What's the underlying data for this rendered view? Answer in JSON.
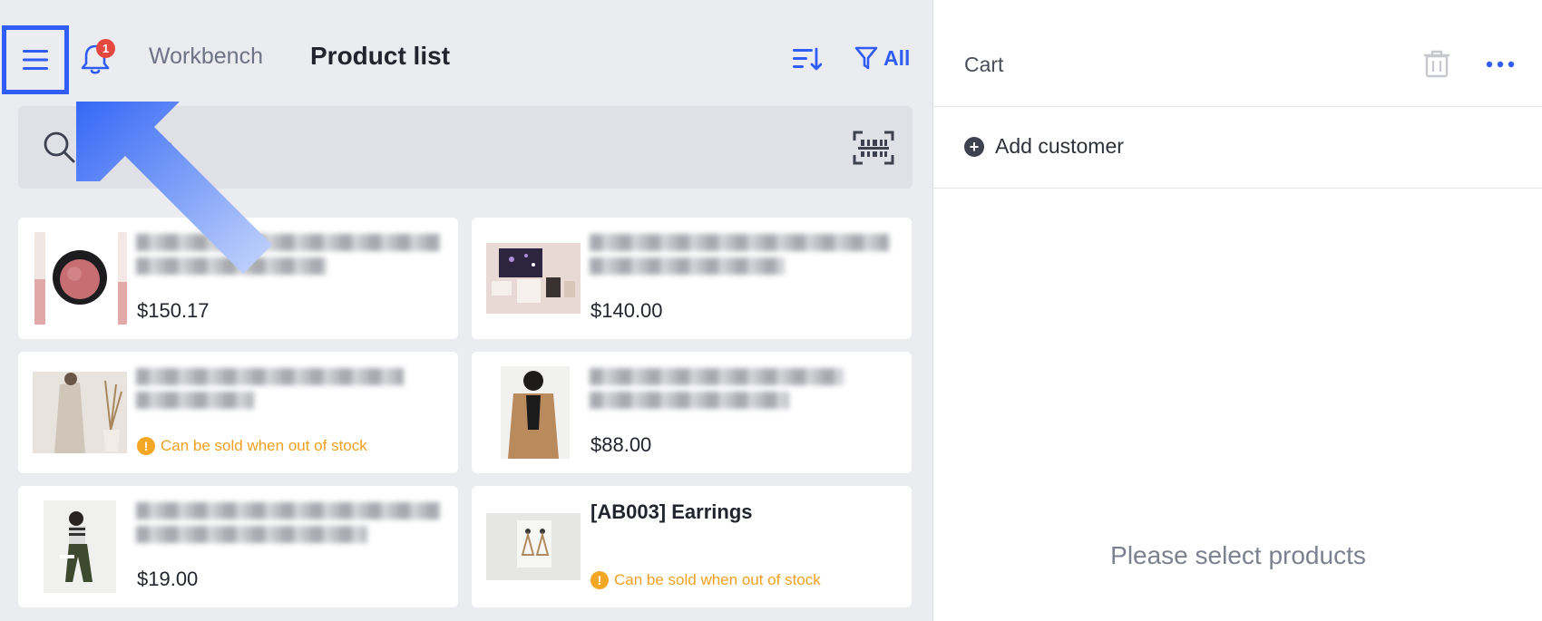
{
  "header": {
    "notification_count": "1",
    "tab_workbench": "Workbench",
    "tab_product_list": "Product list",
    "filter_label": "All"
  },
  "search": {
    "placeholder": "Search"
  },
  "products": [
    {
      "name": "",
      "price": "$150.17",
      "stock_note": ""
    },
    {
      "name": "",
      "price": "$140.00",
      "stock_note": ""
    },
    {
      "name": "",
      "price": "",
      "stock_note": "Can be sold when out of stock"
    },
    {
      "name": "",
      "price": "$88.00",
      "stock_note": ""
    },
    {
      "name": "",
      "price": "$19.00",
      "stock_note": ""
    },
    {
      "name": "[AB003] Earrings",
      "price": "",
      "stock_note": "Can be sold when out of stock"
    }
  ],
  "cart": {
    "title": "Cart",
    "add_customer_label": "Add customer",
    "empty_message": "Please select products"
  },
  "colors": {
    "accent": "#2f5df5",
    "warning": "#f0a020",
    "badge": "#e5483f"
  },
  "icons": {
    "menu": "hamburger-icon",
    "notifications": "bell-icon",
    "sort": "sort-icon",
    "filter": "funnel-icon",
    "search": "search-icon",
    "scan": "barcode-scan-icon",
    "trash": "trash-icon",
    "more": "more-dots-icon",
    "add": "plus-circle-icon",
    "warning": "exclamation-circle-icon"
  }
}
